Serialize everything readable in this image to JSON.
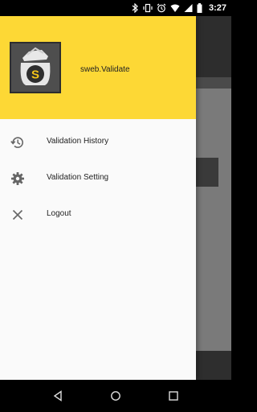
{
  "status_bar": {
    "time": "3:27"
  },
  "drawer": {
    "app_name": "sweb.Validate",
    "menu": [
      {
        "label": "Validation History",
        "icon": "history-icon"
      },
      {
        "label": "Validation Setting",
        "icon": "gear-icon"
      },
      {
        "label": "Logout",
        "icon": "close-icon"
      }
    ]
  },
  "colors": {
    "header": "#fdd835",
    "drawer_bg": "#fafafa",
    "logo_bg": "#4e4e4e",
    "logo_accent": "#f5c518"
  }
}
